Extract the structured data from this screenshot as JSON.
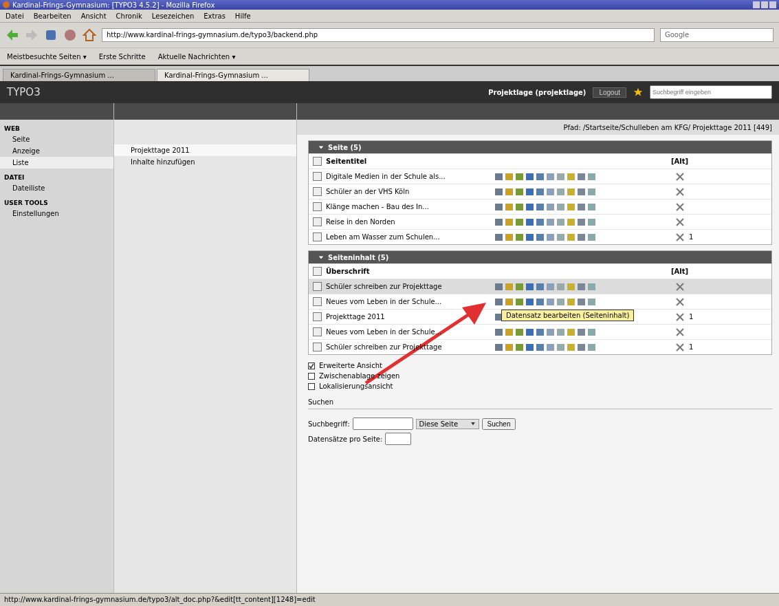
{
  "window": {
    "title": "Kardinal-Frings-Gymnasium: [TYPO3 4.5.2] - Mozilla Firefox"
  },
  "menu": [
    "Datei",
    "Bearbeiten",
    "Ansicht",
    "Chronik",
    "Lesezeichen",
    "Extras",
    "Hilfe"
  ],
  "address": {
    "url": "http://www.kardinal-frings-gymnasium.de/typo3/backend.php"
  },
  "web_search": {
    "placeholder": "Google"
  },
  "bookmarks": [
    "Meistbesuchte Seiten ▾",
    "Erste Schritte",
    "Aktuelle Nachrichten ▾"
  ],
  "tabs": [
    {
      "label": "Kardinal-Frings-Gymnasium ...",
      "selected": false
    },
    {
      "label": "Kardinal-Frings-Gymnasium ...",
      "selected": true
    }
  ],
  "typo3_bar": {
    "logo": "TYPO3",
    "user": "Projektlage (projektlage)",
    "logout": "Logout",
    "search_placeholder": "Suchbegriff eingeben"
  },
  "sidebar": [
    {
      "heading": "WEB",
      "items": [
        {
          "label": "Seite",
          "selected": false
        },
        {
          "label": "Anzeige",
          "selected": false
        },
        {
          "label": "Liste",
          "selected": true
        }
      ]
    },
    {
      "heading": "DATEI",
      "items": [
        {
          "label": "Dateiliste",
          "selected": false
        }
      ]
    },
    {
      "heading": "USER TOOLS",
      "items": [
        {
          "label": "Einstellungen",
          "selected": false
        }
      ]
    }
  ],
  "page_tree": [
    {
      "label": "Projekttage 2011",
      "selected": true
    },
    {
      "label": "Inhalte hinzufügen",
      "selected": false
    }
  ],
  "path": "Pfad: /Startseite/Schulleben am KFG/ Projekttage 2011 [449]",
  "tables": [
    {
      "title": "Seite (5)",
      "expanded": true,
      "header": "Seitentitel",
      "header_right": "[Alt]",
      "rows": [
        {
          "title": "Digitale Medien in der Schule als...",
          "selected": false,
          "count": ""
        },
        {
          "title": "Schüler an der VHS Köln",
          "selected": false,
          "count": ""
        },
        {
          "title": "Klänge machen - Bau des In...",
          "selected": false,
          "count": ""
        },
        {
          "title": "Reise in den Norden",
          "selected": false,
          "count": ""
        },
        {
          "title": "Leben am Wasser zum Schulen...",
          "selected": false,
          "count": "1"
        }
      ]
    },
    {
      "title": "Seiteninhalt (5)",
      "expanded": true,
      "header": "Überschrift",
      "header_right": "[Alt]",
      "rows": [
        {
          "title": "Schüler schreiben zur Projekttage",
          "selected": true,
          "count": ""
        },
        {
          "title": "Neues vom Leben in der Schule...",
          "selected": false,
          "count": ""
        },
        {
          "title": "Projekttage 2011",
          "selected": false,
          "count": "1"
        },
        {
          "title": "Neues vom Leben in der Schule...",
          "selected": false,
          "count": ""
        },
        {
          "title": "Schüler schreiben zur Projekttage",
          "selected": false,
          "count": "1"
        }
      ]
    }
  ],
  "tooltip": "Datensatz bearbeiten (Seiteninhalt)",
  "options": [
    {
      "label": "Erweiterte Ansicht",
      "checked": true
    },
    {
      "label": "Zwischenablage zeigen",
      "checked": false
    },
    {
      "label": "Lokalisierungsansicht",
      "checked": false
    }
  ],
  "search": {
    "heading": "Suchen",
    "term_label": "Suchbegriff:",
    "scope": "Diese Seite",
    "button": "Suchen",
    "per_page_label": "Datensätze pro Seite:"
  },
  "status_bar": "http://www.kardinal-frings-gymnasium.de/typo3/alt_doc.php?&edit[tt_content][1248]=edit"
}
